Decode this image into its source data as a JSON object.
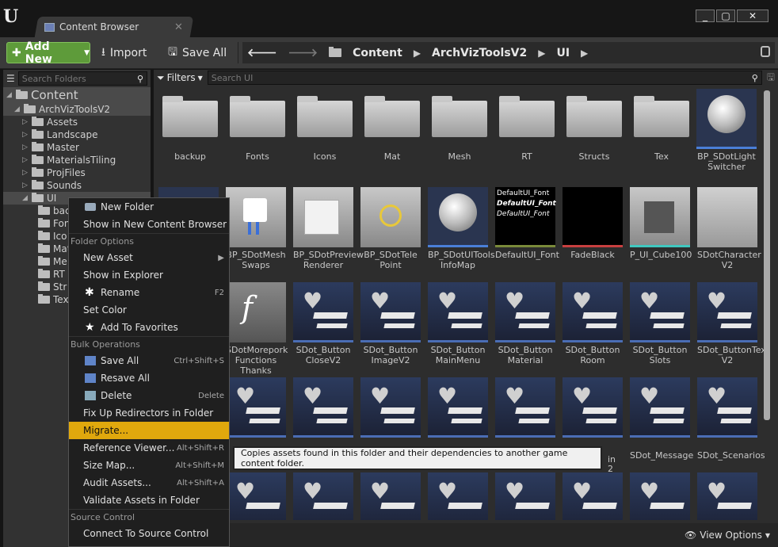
{
  "window": {
    "title": "Content Browser",
    "controls": [
      "_",
      "▢",
      "✕"
    ]
  },
  "toolbar": {
    "add_new": "Add New",
    "import": "Import",
    "save_all": "Save All"
  },
  "breadcrumb": [
    "Content",
    "ArchVizToolsV2",
    "UI"
  ],
  "sidebar": {
    "search_placeholder": "Search Folders",
    "root": "Content",
    "project": "ArchVizToolsV2",
    "folders": [
      "Assets",
      "Landscape",
      "Master",
      "MaterialsTiling",
      "ProjFiles",
      "Sounds"
    ],
    "selected": "UI",
    "ui_children": [
      "bac",
      "Fon",
      "Ico",
      "Mat",
      "Me",
      "RT",
      "Str",
      "Tex"
    ]
  },
  "main": {
    "filters_label": "Filters",
    "search_placeholder": "Search UI",
    "view_options": "View Options"
  },
  "assets": {
    "row1": [
      "backup",
      "Fonts",
      "Icons",
      "Mat",
      "Mesh",
      "RT",
      "Structs",
      "Tex",
      "BP_SDotLight Switcher"
    ],
    "row2": [
      "",
      "BP_SDotMesh Swaps",
      "BP_SDotPreview Renderer",
      "BP_SDotTele Point",
      "BP_SDotUITools InfoMap",
      "DefaultUI_Font",
      "FadeBlack",
      "P_UI_Cube100",
      "SDotCharacter V2"
    ],
    "row3": [
      "SDotMorepork Functions Thanks",
      "SDot_Button CloseV2",
      "SDot_Button ImageV2",
      "SDot_Button MainMenu",
      "SDot_Button Material",
      "SDot_Button Room",
      "SDot_Button Slots",
      "SDot_ButtonText V2"
    ],
    "row4": [
      "",
      "",
      "",
      "",
      "",
      "",
      "SDot_Message",
      "SDot_Scenarios"
    ],
    "font_thumb_lines": [
      "DefaultUI_Font",
      "DefaultUI_Font",
      "DefaultUI_Font"
    ],
    "partial_labels": [
      "in",
      "2"
    ]
  },
  "context_menu": {
    "top": [
      "New Folder",
      "Show in New Content Browser"
    ],
    "folder_options_header": "Folder Options",
    "folder_options": [
      {
        "label": "New Asset",
        "shortcut": ""
      },
      {
        "label": "Show in Explorer",
        "shortcut": ""
      },
      {
        "label": "Rename",
        "shortcut": "F2"
      },
      {
        "label": "Set Color",
        "shortcut": ""
      },
      {
        "label": "Add To Favorites",
        "shortcut": ""
      }
    ],
    "bulk_header": "Bulk Operations",
    "bulk": [
      {
        "label": "Save All",
        "shortcut": "Ctrl+Shift+S"
      },
      {
        "label": "Resave All",
        "shortcut": ""
      },
      {
        "label": "Delete",
        "shortcut": "Delete"
      },
      {
        "label": "Fix Up Redirectors in Folder",
        "shortcut": ""
      },
      {
        "label": "Migrate...",
        "shortcut": ""
      },
      {
        "label": "Reference Viewer...",
        "shortcut": "Alt+Shift+R"
      },
      {
        "label": "Size Map...",
        "shortcut": "Alt+Shift+M"
      },
      {
        "label": "Audit Assets...",
        "shortcut": "Alt+Shift+A"
      },
      {
        "label": "Validate Assets in Folder",
        "shortcut": ""
      }
    ],
    "source_header": "Source Control",
    "source": [
      "Connect To Source Control"
    ]
  },
  "tooltip": "Copies assets found in this folder and their dependencies to another game content folder."
}
